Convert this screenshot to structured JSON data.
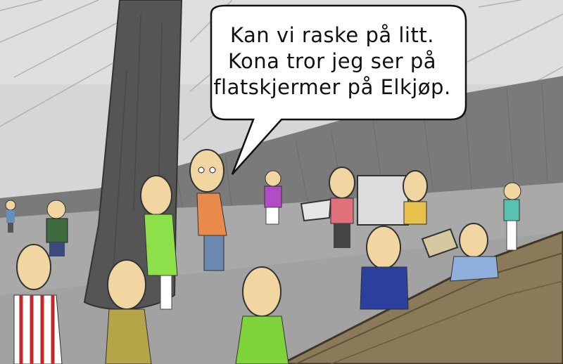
{
  "speech_bubble": {
    "lines": [
      "Kan vi raske på litt.",
      "Kona tror jeg ser på",
      "flatskjermer på Elkjøp."
    ]
  }
}
